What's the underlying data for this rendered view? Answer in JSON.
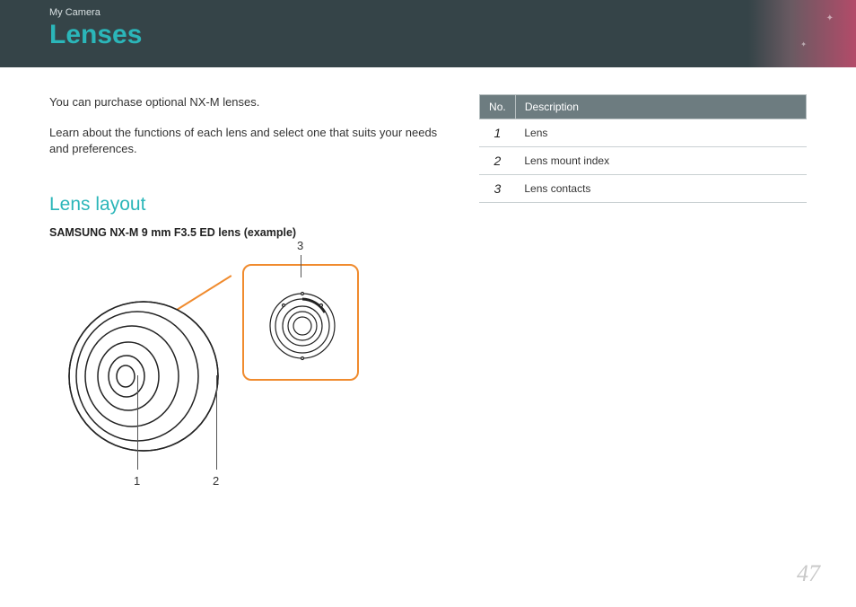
{
  "header": {
    "breadcrumb": "My Camera",
    "title": "Lenses"
  },
  "intro": {
    "p1": "You can purchase optional NX-M lenses.",
    "p2": "Learn about the functions of each lens and select one that suits your needs and preferences."
  },
  "section": {
    "title": "Lens layout",
    "caption": "SAMSUNG NX-M 9 mm F3.5 ED lens (example)"
  },
  "callouts": {
    "c1": "1",
    "c2": "2",
    "c3": "3"
  },
  "table": {
    "headers": {
      "no": "No.",
      "desc": "Description"
    },
    "rows": [
      {
        "no": "1",
        "desc": "Lens"
      },
      {
        "no": "2",
        "desc": "Lens mount index"
      },
      {
        "no": "3",
        "desc": "Lens contacts"
      }
    ]
  },
  "page_number": "47"
}
